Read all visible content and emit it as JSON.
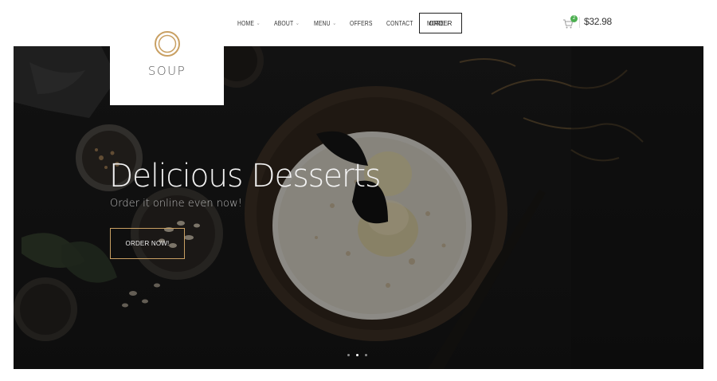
{
  "nav": {
    "items": [
      {
        "label": "HOME",
        "has_dropdown": true
      },
      {
        "label": "ABOUT",
        "has_dropdown": true
      },
      {
        "label": "MENU",
        "has_dropdown": true
      },
      {
        "label": "OFFERS",
        "has_dropdown": false
      },
      {
        "label": "CONTACT",
        "has_dropdown": false
      },
      {
        "label": "MORE",
        "has_dropdown": true
      }
    ],
    "order_label": "ORDER"
  },
  "cart": {
    "count": "2",
    "total": "$32.98",
    "icon": "cart-icon"
  },
  "logo": {
    "text": "SOUP",
    "ring_color": "#c9a063"
  },
  "hero": {
    "headline": "Delicious Desserts",
    "subline": "Order it online even now!",
    "cta_label": "ORDER NOW!",
    "accent": "#c9a063",
    "slides": 3,
    "active_slide": 2
  }
}
